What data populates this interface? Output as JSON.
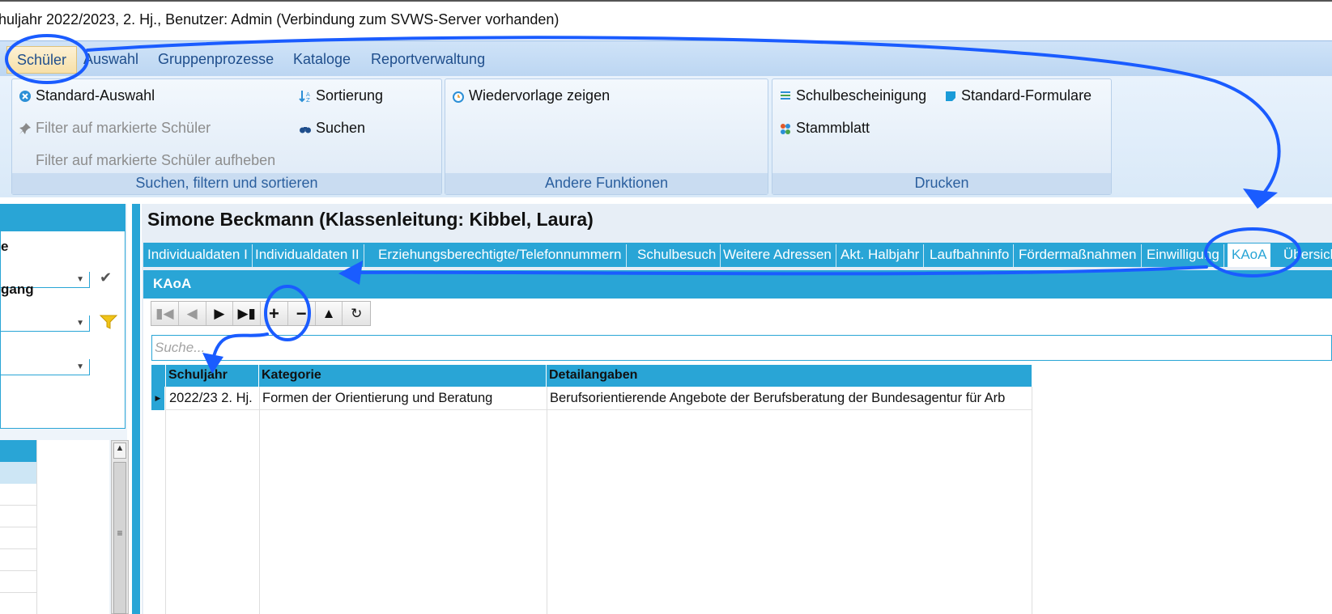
{
  "window": {
    "title": "huljahr 2022/2023, 2. Hj., Benutzer: Admin (Verbindung zum SVWS-Server vorhanden)"
  },
  "menu": {
    "items": [
      "Schüler",
      "Auswahl",
      "Gruppenprozesse",
      "Kataloge",
      "Reportverwaltung"
    ],
    "active": "Schüler"
  },
  "ribbon": {
    "group1": {
      "caption": "Suchen, filtern und sortieren",
      "standard_auswahl": "Standard-Auswahl",
      "filter_markierte": "Filter auf markierte Schüler",
      "filter_aufheben": "Filter auf markierte Schüler aufheben",
      "sortierung": "Sortierung",
      "suchen": "Suchen"
    },
    "group2": {
      "caption": "Andere Funktionen",
      "wiedervorlage": "Wiedervorlage zeigen"
    },
    "group3": {
      "caption": "Drucken",
      "schulbescheinigung": "Schulbescheinigung",
      "standard_formulare": "Standard-Formulare",
      "stammblatt": "Stammblatt"
    }
  },
  "left_panel": {
    "label1": "e",
    "label2": "gang"
  },
  "student": {
    "header": "Simone Beckmann (Klassenleitung: Kibbel, Laura)"
  },
  "tabs": [
    "Individualdaten I",
    "Individualdaten II",
    "Erziehungsberechtigte/Telefonnummern",
    "Schulbesuch",
    "Weitere Adressen",
    "Akt. Halbjahr",
    "Laufbahninfo",
    "Fördermaßnahmen",
    "Einwilligung",
    "KAoA",
    "Übersich"
  ],
  "active_tab": "KAoA",
  "kaoa": {
    "heading": "KAoA",
    "search_placeholder": "Suche...",
    "columns": [
      "Schuljahr",
      "Kategorie",
      "Detailangaben"
    ],
    "rows": [
      {
        "schuljahr": "2022/23 2. Hj.",
        "kategorie": "Formen der Orientierung und Beratung",
        "detail": "Berufsorientierende Angebote der Berufsberatung der Bundesagentur für Arb"
      }
    ]
  },
  "colors": {
    "accent": "#29a5d6",
    "menu_text": "#1f4e8c",
    "annotation": "#1a5cff"
  }
}
